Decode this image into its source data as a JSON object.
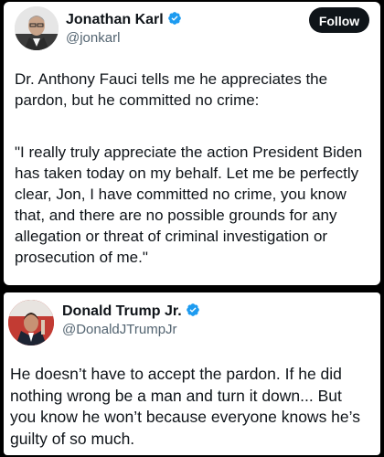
{
  "tweet1": {
    "name": "Jonathan Karl",
    "handle": "@jonkarl",
    "follow_label": "Follow",
    "paragraphs": [
      "Dr. Anthony Fauci tells me he appreciates the pardon, but he committed no crime:",
      "\"I really truly appreciate the action President Biden has taken today on my behalf.  Let me be perfectly clear, Jon, I have committed no crime, you know that, and there are no possible grounds for any allegation or threat of criminal investigation or prosecution of me.\""
    ]
  },
  "tweet2": {
    "name": "Donald Trump Jr.",
    "handle": "@DonaldJTrumpJr",
    "text": "He doesn’t have to accept the pardon. If he did nothing wrong be a man and turn it down... But you know he won’t because everyone knows he’s guilty of so much."
  },
  "colors": {
    "verified": "#1d9bf0",
    "follow_bg": "#0f1419",
    "handle": "#536471",
    "background": "#000000"
  },
  "icons": {
    "verified": "verified-badge-icon"
  }
}
